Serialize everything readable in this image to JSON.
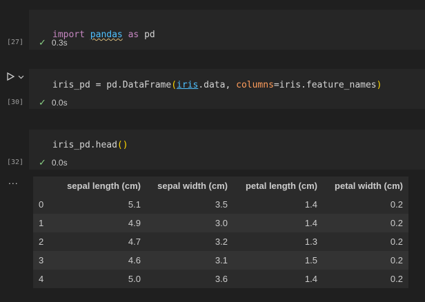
{
  "cells": [
    {
      "count": "[27]",
      "code": {
        "kw": "import",
        "mod": "pandas",
        "as": "as",
        "alias": "pd"
      },
      "status": "0.3s"
    },
    {
      "count": "[30]",
      "code": {
        "lhs": "iris_pd = pd.DataFrame",
        "open": "(",
        "arg1": "iris",
        "arg1_rest": ".data, ",
        "kwarg": "columns",
        "eq": "=",
        "kwval": "iris.feature_names",
        "close": ")"
      },
      "status": "0.0s"
    },
    {
      "count": "[32]",
      "code": {
        "text": "iris_pd.head",
        "parens": "()"
      },
      "status": "0.0s"
    }
  ],
  "icons": {
    "run": "play-icon",
    "chevron": "chevron-down-icon",
    "check": "check-icon",
    "more": "more-icon"
  },
  "more_label": "...",
  "table": {
    "columns": [
      "",
      "sepal length (cm)",
      "sepal width (cm)",
      "petal length (cm)",
      "petal width (cm)"
    ],
    "rows": [
      [
        "0",
        "5.1",
        "3.5",
        "1.4",
        "0.2"
      ],
      [
        "1",
        "4.9",
        "3.0",
        "1.4",
        "0.2"
      ],
      [
        "2",
        "4.7",
        "3.2",
        "1.3",
        "0.2"
      ],
      [
        "3",
        "4.6",
        "3.1",
        "1.5",
        "0.2"
      ],
      [
        "4",
        "5.0",
        "3.6",
        "1.4",
        "0.2"
      ]
    ]
  }
}
